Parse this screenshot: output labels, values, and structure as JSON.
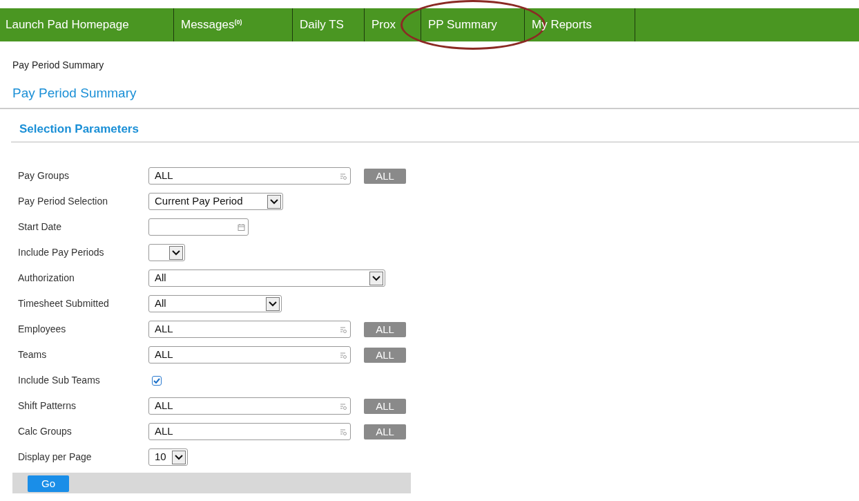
{
  "nav": [
    {
      "label": "Launch Pad Homepage",
      "circled": false
    },
    {
      "label": "Messages$^{(0)}$",
      "circled": false
    },
    {
      "label": "Daily TS",
      "circled": false
    },
    {
      "label": "Prox",
      "circled": false
    },
    {
      "label": "PP Summary",
      "circled": true
    },
    {
      "label": "My Reports",
      "circled": false
    }
  ],
  "breadcrumb": "Pay Period Summary",
  "page_title": "Pay Period Summary",
  "section_title": "Selection Parameters",
  "fields": [
    {
      "label": "Pay Groups",
      "kind": "lookup",
      "value": "ALL",
      "button": "ALL"
    },
    {
      "label": "Pay Period Selection",
      "kind": "select",
      "value": "Current Pay Period"
    },
    {
      "label": "Start Date",
      "kind": "date"
    },
    {
      "label": "Include Pay Periods",
      "kind": "select"
    },
    {
      "label": "Authorization",
      "kind": "select",
      "value": "All"
    },
    {
      "label": "Timesheet Submitted",
      "kind": "select",
      "value": "All"
    },
    {
      "label": "Employees",
      "kind": "lookup",
      "value": "ALL",
      "button": "ALL"
    },
    {
      "label": "Teams",
      "kind": "lookup",
      "value": "ALL",
      "button": "ALL"
    },
    {
      "label": "Include Sub Teams",
      "kind": "checkbox",
      "checked": true
    },
    {
      "label": "Shift Patterns",
      "kind": "lookup",
      "value": "ALL",
      "button": "ALL"
    },
    {
      "label": "Calc Groups",
      "kind": "lookup",
      "value": "ALL",
      "button": "ALL"
    },
    {
      "label": "Display per Page",
      "kind": "select",
      "value": "10"
    }
  ],
  "go_button": "Go"
}
